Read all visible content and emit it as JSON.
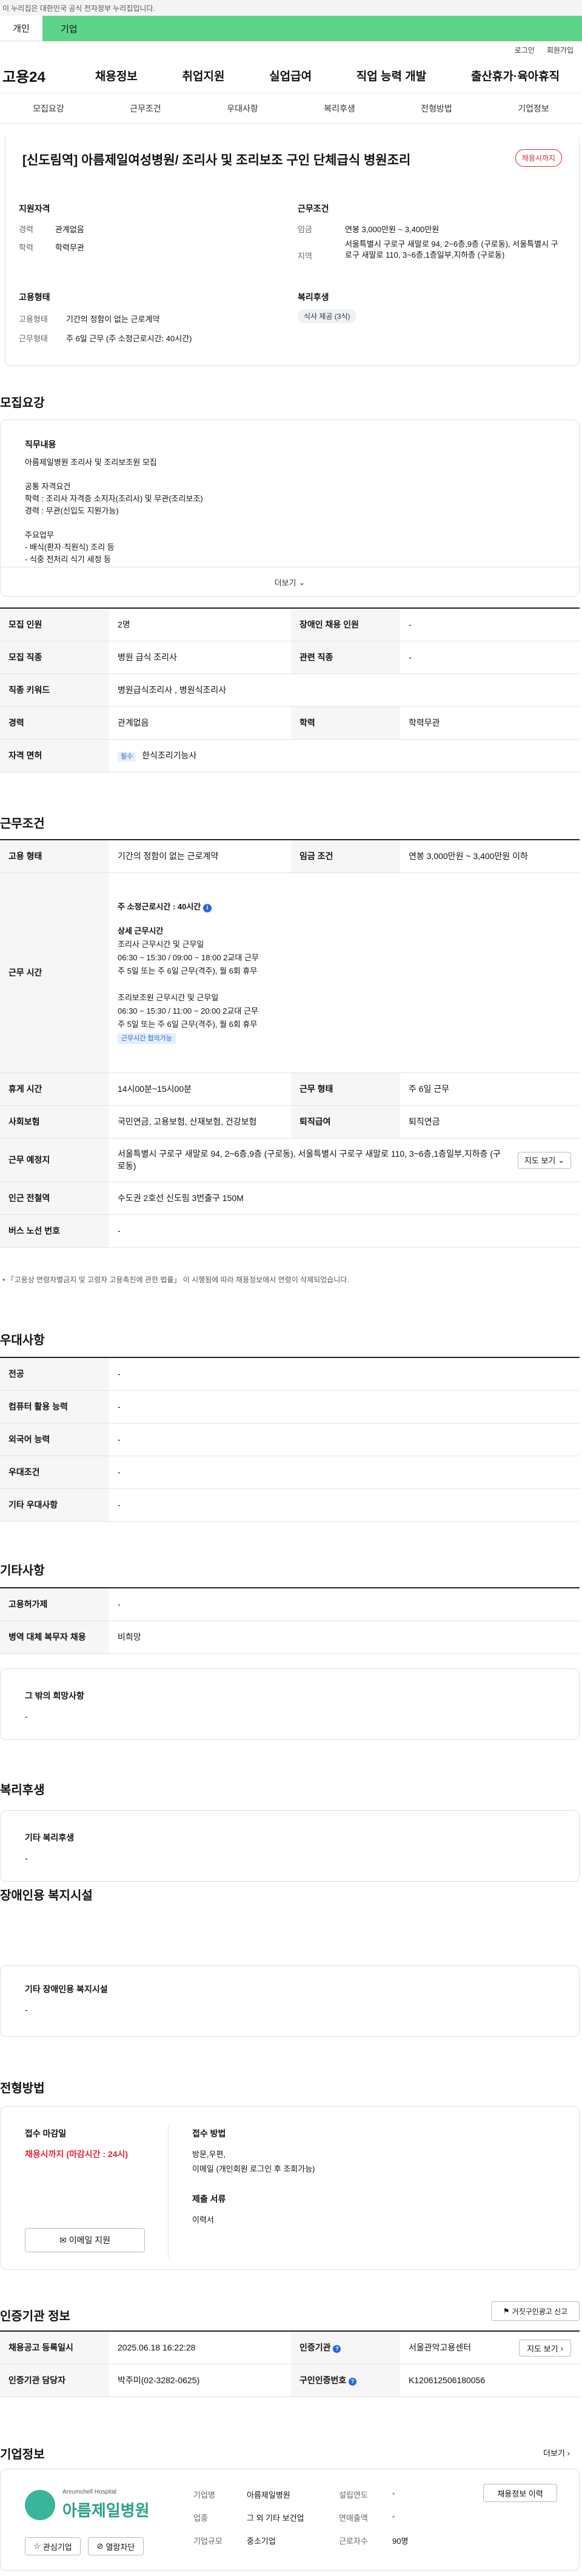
{
  "gov_banner": "이 누리집은 대한민국 공식 전자정부 누리집입니다.",
  "tabs": {
    "individual": "개인",
    "corporate": "기업"
  },
  "util": {
    "login": "로그인",
    "join": "회원가입"
  },
  "logo": "고용24",
  "gnb": [
    "채용정보",
    "취업지원",
    "실업급여",
    "직업 능력 개발",
    "출산휴가·육아휴직"
  ],
  "snb": [
    "모집요강",
    "근무조건",
    "우대사항",
    "복리후생",
    "전형방법",
    "기업정보"
  ],
  "header": {
    "title": "[신도림역] 아름제일여성병원/ 조리사 및 조리보조 구인 단체급식 병원조리",
    "status_badge": "채용시까지",
    "qualifications_title": "지원자격",
    "career_label": "경력",
    "career_value": "관계없음",
    "education_label": "학력",
    "education_value": "학력무관",
    "employment_title": "고용형태",
    "emp_type_label": "고용형태",
    "emp_type_value": "기간의 정함이 없는 근로계약",
    "work_type_label": "근무형태",
    "work_type_value": "주 6일 근무 (주 소정근로시간: 40시간)",
    "conditions_title": "근무조건",
    "wage_label": "임금",
    "wage_value": "연봉 3,000만원 ~ 3,400만원",
    "region_label": "지역",
    "region_value": "서울특별시 구로구 새말로 94, 2~6층,9층 (구로동), 서울특별시 구로구 새말로 110, 3~6층,1층일부,지하층 (구로동)",
    "welfare_title": "복리후생",
    "welfare_tag": "식사 제공 (3식)"
  },
  "recruit": {
    "title": "모집요강",
    "job_desc_title": "직무내용",
    "job_desc_lines": [
      "아름제일병원 조리사 및 조리보조원 모집",
      "",
      "공통 자격요건",
      "학력 : 조리사 자격증 소지자(조리사) 및 무관(조리보조)",
      "경력 : 무관(신입도 지원가능)",
      "",
      "주요업무",
      "- 배식(환자·직원식) 조리 등",
      "- 식중 전처리 식기 세정 등"
    ],
    "more": "더보기",
    "rows": [
      {
        "k1": "모집 인원",
        "v1": "2명",
        "k2": "장애인 채용 인원",
        "v2": "-"
      },
      {
        "k1": "모집 직종",
        "v1": "병원 급식 조리사",
        "k2": "관련 직종",
        "v2": "-"
      },
      {
        "k1": "직종 키워드",
        "v1": "병원급식조리사 , 병원식조리사",
        "k2": "",
        "v2": ""
      },
      {
        "k1": "경력",
        "v1": "관계없음",
        "k2": "학력",
        "v2": "학력무관"
      }
    ],
    "license_label": "자격 면허",
    "license_badge": "필수",
    "license_value": "한식조리기능사"
  },
  "conditions": {
    "title": "근무조건",
    "emp_label": "고용 형태",
    "emp_value": "기간의 정함이 없는 근로계약",
    "wage_label": "임금 조건",
    "wage_value": "연봉 3,000만원 ~ 3,400만원 이하",
    "hours_label": "근무 시간",
    "hours_summary": "주 소정근로시간 : 40시간",
    "hours_lines": [
      "상세 근무시간",
      "조리사 근무시간 및 근무일",
      "06:30 ~ 15:30 / 09:00 ~ 18:00 2교대 근무",
      "주 5일 또는 주 6일 근무(격주), 월 6회 휴무",
      "",
      "조리보조원 근무시간 및 근무일",
      "06:30 ~ 15:30 / 11:00 ~ 20:00 2교대 근무",
      "주 5일 또는 주 6일 근무(격주), 월 6회 휴무"
    ],
    "hours_link": "근무시간 협의가능",
    "rest_label": "휴게 시간",
    "rest_value": "14시00분~15시00분",
    "worktype_label": "근무 형태",
    "worktype_value": "주 6일 근무",
    "insurance_label": "사회보험",
    "insurance_value": "국민연금, 고용보험, 산재보험, 건강보험",
    "retire_label": "퇴직급여",
    "retire_value": "퇴직연금",
    "location_label": "근무 예정지",
    "location_value": "서울특별시 구로구 새말로 94, 2~6층,9층 (구로동), 서울특별시 구로구 새말로 110, 3~6층,1층일부,지하층 (구로동)",
    "map_button": "지도 보기",
    "subway_label": "인근 전철역",
    "subway_value": "수도권 2호선 신도림 3번출구 150M",
    "bus_label": "버스 노선 번호",
    "bus_value": "-",
    "note": "「고용상 연령차별금지 및 고령자 고용촉진에 관한 법률」 이 시행됨에 따라 채용정보에서 연령이 삭제되었습니다."
  },
  "preference": {
    "title": "우대사항",
    "rows": [
      {
        "k": "전공",
        "v": "-"
      },
      {
        "k": "컴퓨터 활용 능력",
        "v": "-"
      },
      {
        "k": "외국어 능력",
        "v": "-"
      },
      {
        "k": "우대조건",
        "v": "-"
      },
      {
        "k": "기타 우대사항",
        "v": "-"
      }
    ]
  },
  "etc": {
    "title": "기타사항",
    "rows": [
      {
        "k": "고용허가제",
        "v": "-"
      },
      {
        "k": "병역 대체 복무자 채용",
        "v": "비희망"
      }
    ],
    "box_title": "그 밖의 희망사항",
    "box_value": "-"
  },
  "welfare": {
    "title": "복리후생",
    "box_title": "기타 복리후생",
    "box_value": "-"
  },
  "disability": {
    "title": "장애인용 복지시설",
    "box_title": "기타 장애인용 복지시설",
    "box_value": "-"
  },
  "selection": {
    "title": "전형방법",
    "deadline_title": "접수 마감일",
    "deadline_value": "채용시까지 (마감시간 : 24시)",
    "email_button": "이메일 지원",
    "method_title": "접수 방법",
    "method_value": "방문,우편,",
    "method_extra": "이메일 (개인회원 로그인 후 조회가능)",
    "docs_title": "제출 서류",
    "docs_value": "이력서"
  },
  "agency": {
    "title": "인증기관 정보",
    "report_button": "거짓구인광고 신고",
    "reg_date_label": "채용공고 등록일시",
    "reg_date_value": "2025.06.18 16:22:28",
    "agency_label": "인증기관",
    "agency_value": "서울관악고용센터",
    "map_button": "지도 보기",
    "manager_label": "인증기관 담당자",
    "manager_value": "박주미(02-3282-0625)",
    "number_label": "구인인증번호",
    "number_value": "K120612506180056"
  },
  "company": {
    "title": "기업정보",
    "more": "더보기",
    "logo_en": "Areumchell Hospital",
    "logo_ko": "아름제일병원",
    "fav_button": "관심기업",
    "hide_button": "열람차단",
    "name_label": "기업명",
    "name_value": "아름제일병원",
    "industry_label": "업종",
    "industry_value": "그 외 기타 보건업",
    "size_label": "기업규모",
    "size_value": "중소기업",
    "founded_label": "설립연도",
    "founded_value": "-",
    "revenue_label": "연매출액",
    "revenue_value": "-",
    "employees_label": "근로자수",
    "employees_value": "90명",
    "jobs_button": "채용정보 이력"
  },
  "colors": {
    "green": "#5ed38a",
    "red": "#e0283a",
    "blue": "#2a67d6"
  }
}
